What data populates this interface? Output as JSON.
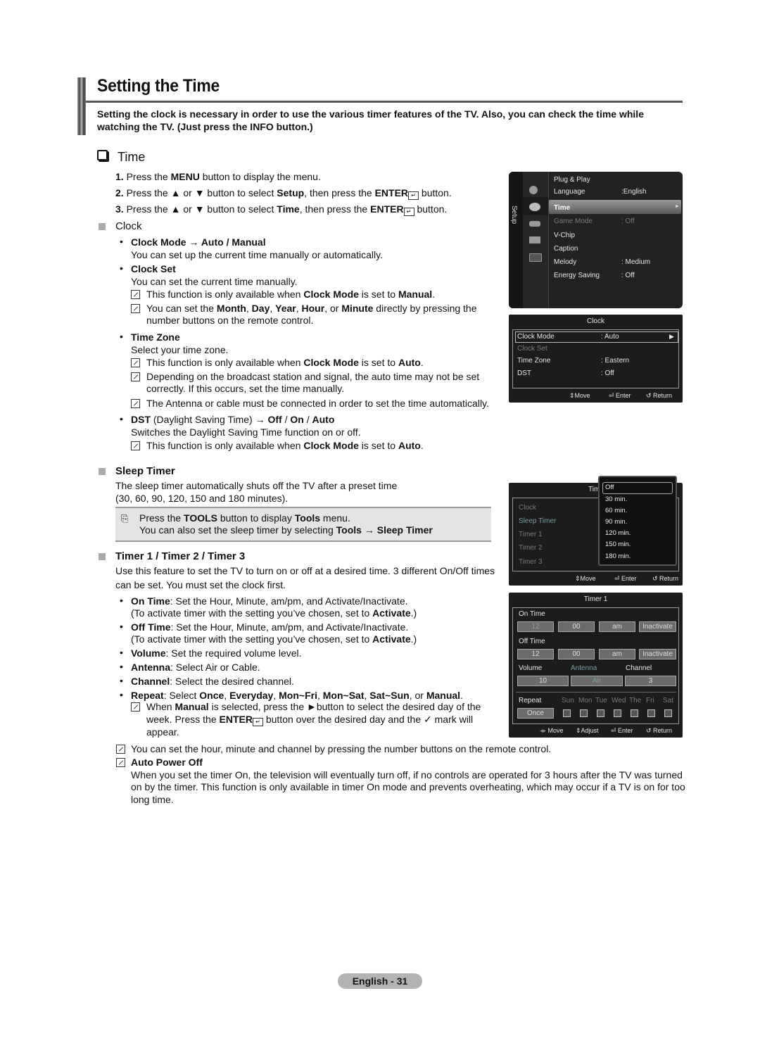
{
  "header": {
    "title": "Setting the Time",
    "intro": "Setting the clock is necessary in order to use the various timer features of the TV. Also, you can check the time while watching the TV. (Just press the INFO button.)"
  },
  "section": {
    "title": "Time"
  },
  "steps": [
    {
      "num": "1.",
      "text": "Press the MENU button to display the menu."
    },
    {
      "num": "2.",
      "text": "Press the ▲ or ▼ button to select Setup, then press the ENTER button."
    },
    {
      "num": "3.",
      "text": "Press the ▲ or ▼ button to select Time, then press the ENTER button."
    }
  ],
  "clock": {
    "heading": "Clock",
    "clock_mode": {
      "title": "Clock Mode → Auto / Manual",
      "desc": "You can set up the current time manually or automatically."
    },
    "clock_set": {
      "title": "Clock Set",
      "desc": "You can set the current time manually.",
      "note1": "This function is only available when Clock Mode is set to Manual.",
      "note2a": "You can set the Month, Day, Year, Hour, or Minute directly by pressing the",
      "note2b": "number buttons on the remote control."
    },
    "time_zone": {
      "title": "Time Zone",
      "desc": "Select your time zone.",
      "note1": "This function is only available when Clock Mode is set to Auto.",
      "note2a": "Depending on the broadcast station and signal, the auto time may not be set",
      "note2b": "correctly. If this occurs, set the time manually.",
      "note3": "The Antenna or cable must be connected in order to set the time automatically."
    },
    "dst": {
      "title": "DST (Daylight Saving Time) → Off / On / Auto",
      "desc": "Switches the Daylight Saving Time function on or off.",
      "note1": "This function is only available when Clock Mode is set to Auto."
    }
  },
  "sleep": {
    "heading": "Sleep Timer",
    "desc1": "The sleep timer automatically shuts off the TV after a preset time",
    "desc2": "(30, 60, 90, 120, 150 and 180 minutes).",
    "tools1": "Press the TOOLS button to display Tools menu.",
    "tools2": "You can also set the sleep timer by selecting Tools → Sleep Timer"
  },
  "timers": {
    "heading": "Timer 1 / Timer 2 / Timer 3",
    "desc1": "Use this feature to set the TV to turn on or off at a desired time. 3 different On/Off times",
    "desc2": "can be set. You must set the clock first.",
    "items": [
      {
        "a": "On Time: Set the Hour, Minute, am/pm, and Activate/Inactivate.",
        "b": "(To activate timer with the setting you've chosen, set to Activate.)"
      },
      {
        "a": "Off Time: Set the Hour, Minute, am/pm, and Activate/Inactivate.",
        "b": "(To activate timer with the setting you've chosen, set to Activate.)"
      },
      {
        "a": "Volume: Set the required volume level."
      },
      {
        "a": "Antenna: Select Air or Cable."
      },
      {
        "a": "Channel: Select the desired channel."
      },
      {
        "a": "Repeat: Select Once, Everyday, Mon~Fri, Mon~Sat, Sat~Sun, or Manual."
      }
    ],
    "repeat_note1": "When Manual is selected, press the ►button to select the desired day of the",
    "repeat_note2": "week. Press the ENTER button over the desired day and the ✓ mark will",
    "repeat_note3": "appear.",
    "note_numbers": "You can set the hour, minute and channel by pressing the number buttons on the remote control.",
    "auto_power_off_title": "Auto Power Off",
    "auto_power_off_1": "When you set the timer On, the television will eventually turn off, if no controls are operated for 3 hours after the TV was turned",
    "auto_power_off_2": "on by the timer. This function is only available in timer On mode and prevents overheating, which may occur if a TV is on for too",
    "auto_power_off_3": "long time."
  },
  "osd_setup": {
    "side_label": "Setup",
    "items": [
      {
        "label": "Plug & Play",
        "value": ""
      },
      {
        "label": "Language",
        "value": ":English"
      },
      {
        "label": "Time",
        "value": ""
      },
      {
        "label": "Game Mode",
        "value": ": Off"
      },
      {
        "label": "V-Chip",
        "value": ""
      },
      {
        "label": "Caption",
        "value": ""
      },
      {
        "label": "Melody",
        "value": ": Medium"
      },
      {
        "label": "Energy Saving",
        "value": ": Off"
      }
    ],
    "selected": "Time"
  },
  "osd_clock": {
    "title": "Clock",
    "items": [
      {
        "label": "Clock Mode",
        "value": ": Auto"
      },
      {
        "label": "Clock Set",
        "value": ""
      },
      {
        "label": "Time Zone",
        "value": ": Eastern"
      },
      {
        "label": "DST",
        "value": ": Off"
      }
    ],
    "footer": {
      "move": "Move",
      "enter": "Enter",
      "return": "Return"
    }
  },
  "osd_sleep": {
    "title": "Time",
    "items": [
      "Clock",
      "Sleep Timer",
      "Timer 1",
      "Timer 2",
      "Timer 3"
    ],
    "options": [
      "Off",
      "30 min.",
      "60 min.",
      "90 min.",
      "120 min.",
      "150 min.",
      "180 min."
    ],
    "selected_option": "Off",
    "footer": {
      "move": "Move",
      "enter": "Enter",
      "return": "Return"
    }
  },
  "osd_timer": {
    "title": "Timer 1",
    "on_time_label": "On Time",
    "on_time": {
      "hour": "12",
      "minute": "00",
      "ampm": "am",
      "state": "Inactivate"
    },
    "off_time_label": "Off Time",
    "off_time": {
      "hour": "12",
      "minute": "00",
      "ampm": "am",
      "state": "Inactivate"
    },
    "volume_label": "Volume",
    "antenna_label": "Antenna",
    "channel_label": "Channel",
    "volume": "10",
    "antenna": "Air",
    "channel": "3",
    "repeat_label": "Repeat",
    "repeat": "Once",
    "days": [
      "Sun",
      "Mon",
      "Tue",
      "Wed",
      "The",
      "Fri",
      "Sat"
    ],
    "footer": {
      "move": "Move",
      "adjust": "Adjust",
      "enter": "Enter",
      "return": "Return"
    }
  },
  "footer": {
    "page": "English - 31"
  }
}
